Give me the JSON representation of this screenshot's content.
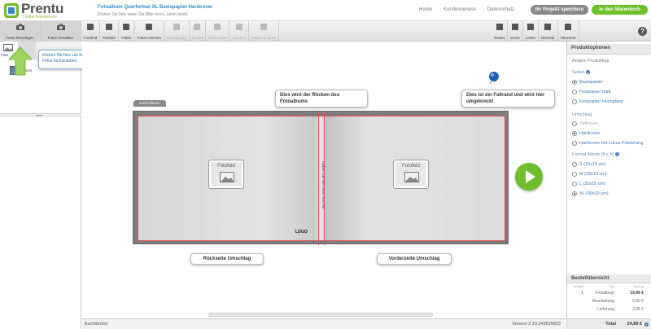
{
  "header": {
    "logo_text": "Prentu",
    "logo_sub": "Online Fotoservice",
    "project_title": "Fotoalbum Querformat XL Basispapier Hardcover",
    "project_hint": "Klicken Sie hier, wenn Sie Bitte hinzu, wenn bleibt.",
    "nav": [
      "Home",
      "Kundenservice",
      "Datenschutz"
    ],
    "save_button": "Ihr Projekt speichern",
    "cart_button": "in den Warenkorb"
  },
  "toolbar": {
    "left": [
      "Fotos hinzufügen",
      "Fotos verwalten"
    ],
    "mid": [
      "Fotofeld",
      "Textfeld",
      "Füllen",
      "Fotos mischen",
      "Rückgängig",
      "Erneut",
      "Extra Seite",
      "Löschen",
      "Kopieren Seite"
    ],
    "mid_disabled": [
      false,
      false,
      false,
      false,
      true,
      true,
      true,
      true,
      true
    ],
    "right": [
      "Raster",
      "Zoom",
      "Letzte",
      "Nächste",
      "Übersicht"
    ]
  },
  "left_panel": {
    "tab1_label": "Foto",
    "photo_label": "Fotos"
  },
  "tooltip": "Klicken Sie hier, um Ihre Fotos hochzuladen.",
  "canvas": {
    "controls_tab": "Kontrollieren",
    "callout_spine": "Dies wird der Rücken des Fotoalbums",
    "callout_fold": "Dies ist ein Faltrand und wird hier umgeknickt",
    "callout_back": "Rückseite Umschlag",
    "callout_front": "Vorderseite Umschlag",
    "photo_field_label": "Fotofeld",
    "spine_text": "Geben Sie hier Ihren Text ein",
    "logo_text": "LOGO"
  },
  "statusbar": {
    "left": "Buchdeckel",
    "right": "Version 2.10.249529823"
  },
  "right_panel": {
    "title": "Produktoptionen",
    "subtitle": "Ändern Produkttyp",
    "pages_section": "Seiten",
    "pages_options": [
      "Basispapier",
      "Fotopapier matt",
      "Fotopapier Hochglanz"
    ],
    "pages_selected": 0,
    "cover_section": "Umschlag",
    "cover_options": [
      "Softcover",
      "Hardcover",
      "Hardcover mit Luxus Polsterung"
    ],
    "cover_selected": 1,
    "cover_disabled": [
      true,
      false,
      false
    ],
    "format_section": "Format Album (b x h)",
    "format_options": [
      "S (15x10 cm)",
      "M (18x13 cm)",
      "L (22x15 cm)",
      "XL (30x20 cm)"
    ],
    "format_selected": 3,
    "order_title": "Bestellübersicht",
    "order_headers": [
      "Anzahl",
      "Typ",
      "Betrag"
    ],
    "order_rows": [
      {
        "qty": "1",
        "type": "Fotoalbum",
        "amount": "19,95 €"
      },
      {
        "qty": "",
        "type": "Bearbeitung",
        "amount": "0,99 €"
      },
      {
        "qty": "",
        "type": "Lieferung",
        "amount": "3,95 €"
      }
    ],
    "total_label": "Total",
    "total_value": "24,89 €"
  },
  "colors": {
    "accent_green": "#6fbe2c",
    "link_blue": "#3a7bc0",
    "bleed_red": "#e05050"
  }
}
